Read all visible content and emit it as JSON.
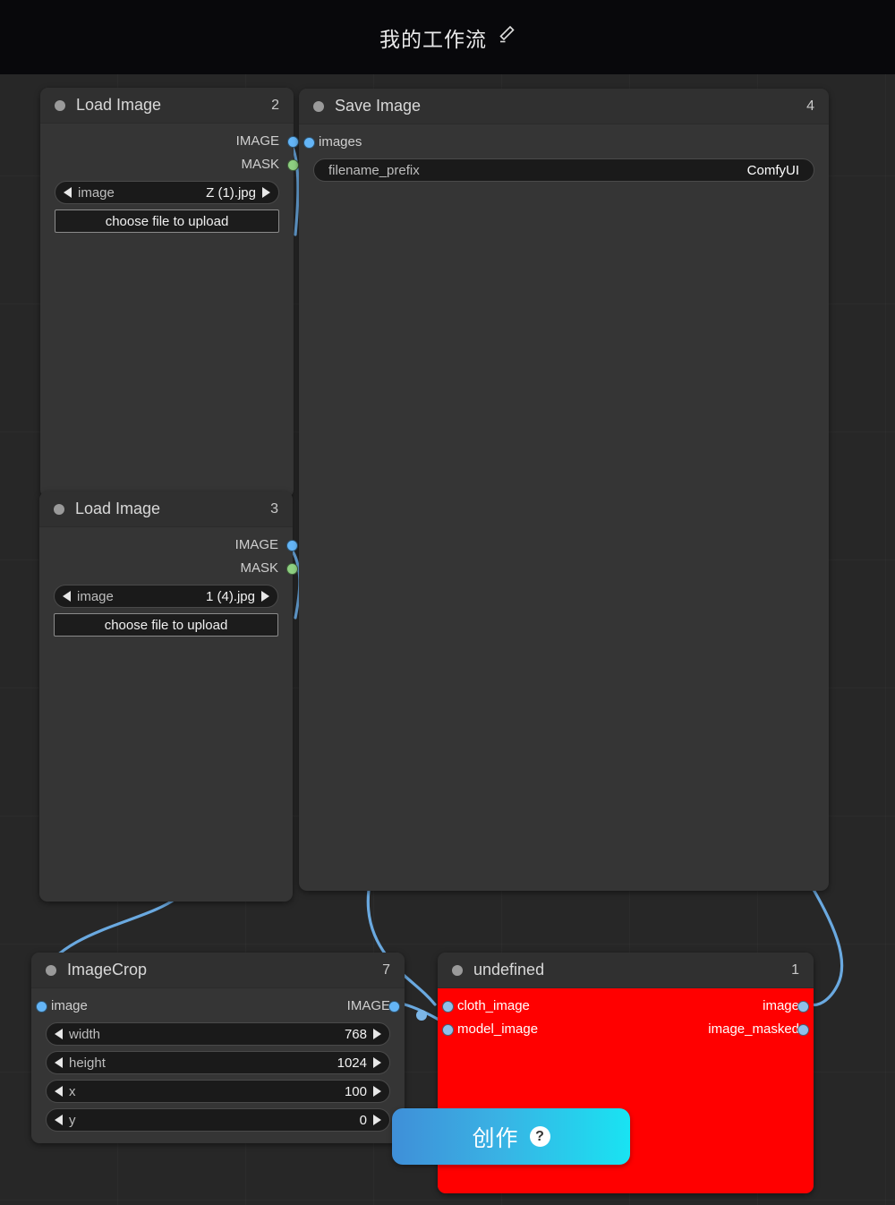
{
  "app": {
    "title": "我的工作流",
    "edit_icon": "pencil-icon"
  },
  "colors": {
    "canvas_bg": "#272727",
    "node_bg": "#353535",
    "node_header_bg": "#303030",
    "error_node_bg": "#ff0000",
    "link": "#6aa9e0",
    "image_slot": "#64b5f6",
    "mask_slot": "#8ed081",
    "button_gradient_from": "#3f8fd8",
    "button_gradient_to": "#19e3f2"
  },
  "nodes": [
    {
      "id": "2",
      "title": "Load Image",
      "outputs": [
        {
          "label": "IMAGE",
          "type": "IMAGE"
        },
        {
          "label": "MASK",
          "type": "MASK"
        }
      ],
      "widgets": [
        {
          "kind": "combo",
          "name": "image",
          "value": "Z (1).jpg"
        },
        {
          "kind": "button",
          "label": "choose file to upload"
        }
      ]
    },
    {
      "id": "3",
      "title": "Load Image",
      "outputs": [
        {
          "label": "IMAGE",
          "type": "IMAGE"
        },
        {
          "label": "MASK",
          "type": "MASK"
        }
      ],
      "widgets": [
        {
          "kind": "combo",
          "name": "image",
          "value": "1 (4).jpg"
        },
        {
          "kind": "button",
          "label": "choose file to upload"
        }
      ]
    },
    {
      "id": "4",
      "title": "Save Image",
      "inputs": [
        {
          "label": "images",
          "type": "IMAGE"
        }
      ],
      "widgets": [
        {
          "kind": "text",
          "name": "filename_prefix",
          "value": "ComfyUI"
        }
      ]
    },
    {
      "id": "7",
      "title": "ImageCrop",
      "inputs": [
        {
          "label": "image",
          "type": "IMAGE"
        }
      ],
      "outputs": [
        {
          "label": "IMAGE",
          "type": "IMAGE"
        }
      ],
      "widgets": [
        {
          "kind": "number",
          "name": "width",
          "value": "768"
        },
        {
          "kind": "number",
          "name": "height",
          "value": "1024"
        },
        {
          "kind": "number",
          "name": "x",
          "value": "100"
        },
        {
          "kind": "number",
          "name": "y",
          "value": "0"
        }
      ]
    },
    {
      "id": "1",
      "title": "undefined",
      "error": true,
      "inputs": [
        {
          "label": "cloth_image",
          "type": "IMAGE"
        },
        {
          "label": "model_image",
          "type": "IMAGE"
        }
      ],
      "outputs": [
        {
          "label": "image",
          "type": "IMAGE"
        },
        {
          "label": "image_masked",
          "type": "IMAGE"
        }
      ]
    }
  ],
  "create_button": {
    "label": "创作",
    "help_icon": "question-mark-icon"
  }
}
